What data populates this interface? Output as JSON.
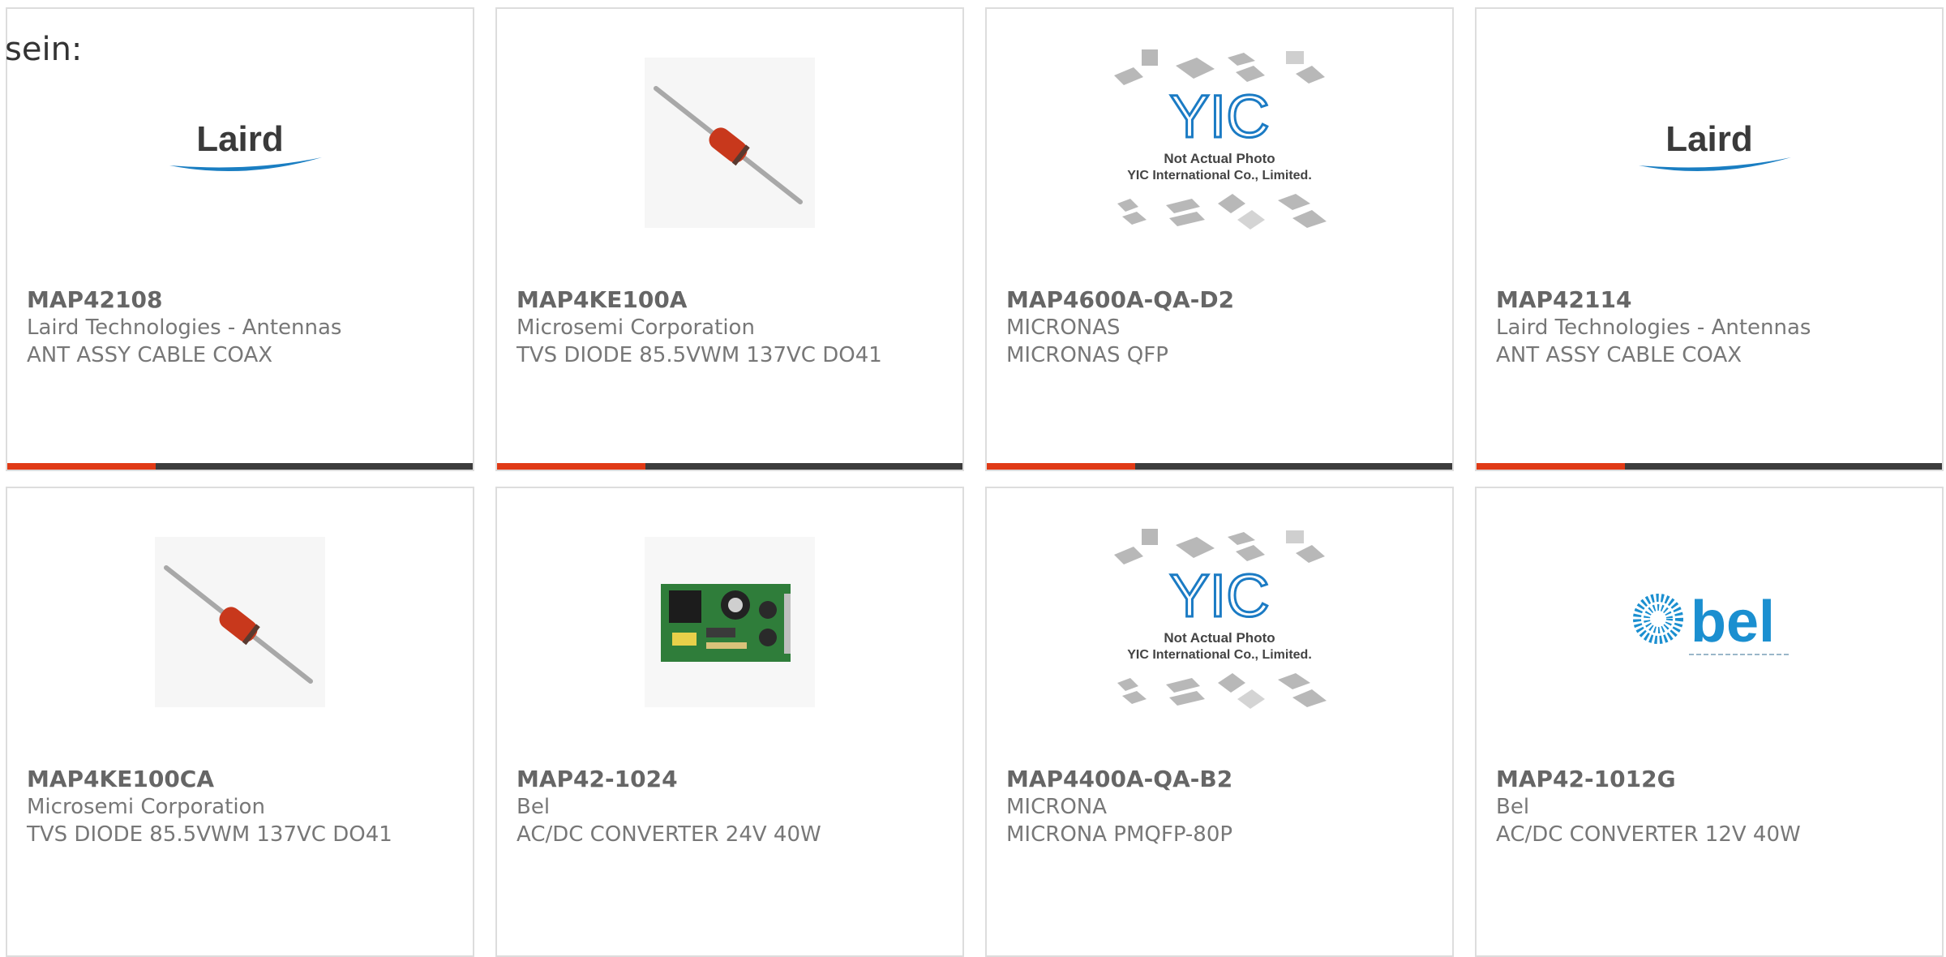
{
  "intro_text": "sein:",
  "colors": {
    "accent": "#e03a16",
    "bar_dark": "#3c3c3c",
    "border": "#dddddd",
    "laird_blue": "#1a7ec2",
    "bel_blue": "#1b8fd0"
  },
  "yic_caption": {
    "line1": "Not Actual Photo",
    "line2": "YIC International Co., Limited."
  },
  "products": [
    {
      "part": "MAP42108",
      "manufacturer": "Laird Technologies - Antennas",
      "description": "ANT ASSY CABLE COAX",
      "image": "laird-logo"
    },
    {
      "part": "MAP4KE100A",
      "manufacturer": "Microsemi Corporation",
      "description": "TVS DIODE 85.5VWM 137VC DO41",
      "image": "diode-photo"
    },
    {
      "part": "MAP4600A-QA-D2",
      "manufacturer": "MICRONAS",
      "description": "MICRONAS QFP",
      "image": "yic-placeholder"
    },
    {
      "part": "MAP42114",
      "manufacturer": "Laird Technologies - Antennas",
      "description": "ANT ASSY CABLE COAX",
      "image": "laird-logo"
    },
    {
      "part": "MAP4KE100CA",
      "manufacturer": "Microsemi Corporation",
      "description": "TVS DIODE 85.5VWM 137VC DO41",
      "image": "diode-photo"
    },
    {
      "part": "MAP42-1024",
      "manufacturer": "Bel",
      "description": "AC/DC CONVERTER 24V 40W",
      "image": "pcb-photo"
    },
    {
      "part": "MAP4400A-QA-B2",
      "manufacturer": "MICRONA",
      "description": "MICRONA PMQFP-80P",
      "image": "yic-placeholder"
    },
    {
      "part": "MAP42-1012G",
      "manufacturer": "Bel",
      "description": "AC/DC CONVERTER 12V 40W",
      "image": "bel-logo"
    }
  ]
}
